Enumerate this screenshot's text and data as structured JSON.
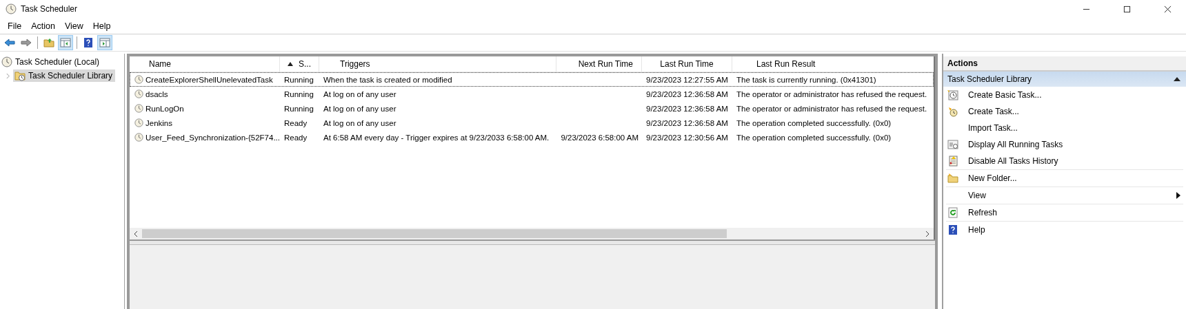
{
  "window": {
    "title": "Task Scheduler"
  },
  "menu": [
    "File",
    "Action",
    "View",
    "Help"
  ],
  "toolbar": [
    {
      "kind": "back",
      "pressed": false
    },
    {
      "kind": "forward",
      "pressed": false
    },
    {
      "kind": "up",
      "pressed": false
    },
    {
      "kind": "tree",
      "pressed": true
    },
    {
      "kind": "help",
      "pressed": false
    },
    {
      "kind": "actions",
      "pressed": true
    }
  ],
  "tree": [
    {
      "label": "Task Scheduler (Local)",
      "selected": false,
      "children": [
        {
          "label": "Task Scheduler Library",
          "selected": true,
          "expanded": false
        }
      ]
    }
  ],
  "table": {
    "columns": [
      {
        "label": "Name",
        "sorted": false
      },
      {
        "label": "S...",
        "sorted": true
      },
      {
        "label": "Triggers",
        "sorted": false
      },
      {
        "label": "Next Run Time",
        "sorted": false
      },
      {
        "label": "Last Run Time",
        "sorted": false
      },
      {
        "label": "Last Run Result",
        "sorted": false
      }
    ],
    "rows": [
      {
        "focused": true,
        "cells": [
          "CreateExplorerShellUnelevatedTask",
          "Running",
          "When the task is created or modified",
          "",
          "9/23/2023 12:27:55 AM",
          "The task is currently running. (0x41301)"
        ]
      },
      {
        "focused": false,
        "cells": [
          "dsacls",
          "Running",
          "At log on of any user",
          "",
          "9/23/2023 12:36:58 AM",
          "The operator or administrator has refused the request."
        ]
      },
      {
        "focused": false,
        "cells": [
          "RunLogOn",
          "Running",
          "At log on of any user",
          "",
          "9/23/2023 12:36:58 AM",
          "The operator or administrator has refused the request."
        ]
      },
      {
        "focused": false,
        "cells": [
          "Jenkins",
          "Ready",
          "At log on of any user",
          "",
          "9/23/2023 12:36:58 AM",
          "The operation completed successfully. (0x0)"
        ]
      },
      {
        "focused": false,
        "cells": [
          "User_Feed_Synchronization-{52F74...",
          "Ready",
          "At 6:58 AM every day - Trigger expires at 9/23/2033 6:58:00 AM.",
          "9/23/2023 6:58:00 AM",
          "9/23/2023 12:30:56 AM",
          "The operation completed successfully. (0x0)"
        ]
      }
    ]
  },
  "actions": {
    "title": "Actions",
    "section": {
      "title": "Task Scheduler Library",
      "expanded": true
    },
    "groups": [
      [
        {
          "label": "Create Basic Task...",
          "kind": "action"
        },
        {
          "label": "Create Task...",
          "kind": "action"
        },
        {
          "label": "Import Task...",
          "kind": "action"
        },
        {
          "label": "Display All Running Tasks",
          "kind": "action"
        },
        {
          "label": "Disable All Tasks History",
          "kind": "action"
        }
      ],
      [
        {
          "label": "New Folder...",
          "kind": "action"
        }
      ],
      [
        {
          "label": "View",
          "kind": "submenu"
        }
      ],
      [
        {
          "label": "Refresh",
          "kind": "action"
        }
      ],
      [
        {
          "label": "Help",
          "kind": "action"
        }
      ]
    ]
  }
}
